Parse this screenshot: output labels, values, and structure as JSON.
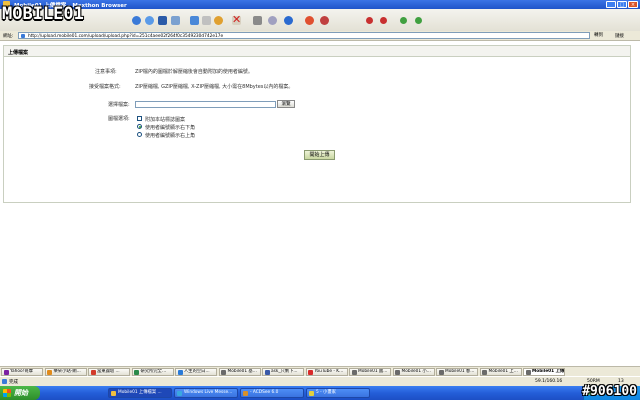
{
  "window": {
    "title": "Mobile01 上傳檔案 - Maxthon Browser"
  },
  "logo": {
    "text": "MOBILE01"
  },
  "toolbar": {
    "icons": [
      "back-icon",
      "forward-icon",
      "stop-icon",
      "refresh-icon",
      "home-icon",
      "search-icon",
      "favorites-icon",
      "history-icon",
      "mail-icon",
      "print-icon",
      "delete-icon",
      "tools-icon",
      "settings-icon",
      "plugin-icon",
      "zoom-icon"
    ]
  },
  "address": {
    "label": "網址:",
    "url": "http://upload.mobile01.com/upload/upload.php?id=251c4aee02f264f0c3549230d742e17e",
    "go_label": "轉到",
    "links_label": "鏈接"
  },
  "panel": {
    "title": "上傳檔案"
  },
  "form": {
    "notice_label": "注意事項:",
    "notice_text": "ZIP檔內的圖檔於解壓縮後會自動附加的使用者編號。",
    "support_label": "接受檔案格式:",
    "support_text": "ZIP壓縮檔, GZIP壓縮檔, X-ZIP壓縮檔, 大小需在8Mbytes以內的檔案。",
    "file_label": "選擇檔案:",
    "browse_label": "瀏覽",
    "opts_label": "圖檔選項:",
    "opt_watermark": "附加本站標誌圖案",
    "opt_bottom_right": "使用者編號顯示右下角",
    "opt_top_right": "使用者編號顯示右上角",
    "submit_label": "開始上傳"
  },
  "tabs": [
    {
      "label": "Yahoo!奇摩",
      "color": "#7b1fa2"
    },
    {
      "label": "樂朵小站-網…",
      "color": "#e08a1a"
    },
    {
      "label": "當東論壇 ...",
      "color": "#d23a2a"
    },
    {
      "label": "研究所完全…",
      "color": "#2a8a4a"
    },
    {
      "label": "人生的空白...",
      "color": "#2a7ad8"
    },
    {
      "label": "Mobile01 基...",
      "color": "#6a6a6a"
    },
    {
      "label": "ask_只剩下...",
      "color": "#3a5aa8"
    },
    {
      "label": "YouTube - K...",
      "color": "#d82a2a"
    },
    {
      "label": "Mobile01 國...",
      "color": "#6a6a6a"
    },
    {
      "label": "Mobile01 小...",
      "color": "#6a6a6a"
    },
    {
      "label": "Mobile01 春...",
      "color": "#6a6a6a"
    },
    {
      "label": "Mobile01 上...",
      "color": "#6a6a6a"
    },
    {
      "label": "Mobile01 上傳",
      "color": "#6a6a6a"
    }
  ],
  "status": {
    "text": "完成",
    "stats": "59.1/160.16",
    "memory": "50RM",
    "count": "13"
  },
  "taskbar": {
    "start": "開始",
    "tasks": [
      {
        "label": "Mobile01 上傳檔案 ...",
        "color": "#f0c040"
      },
      {
        "label": "Windows Live Messe...",
        "color": "#3aa8e0"
      },
      {
        "label": "- ACDSee 6.0",
        "color": "#d8902a"
      },
      {
        "label": "5 - 小畫家",
        "color": "#e0d040"
      }
    ],
    "clock": "上午 10:52"
  },
  "watermark": "#906100"
}
